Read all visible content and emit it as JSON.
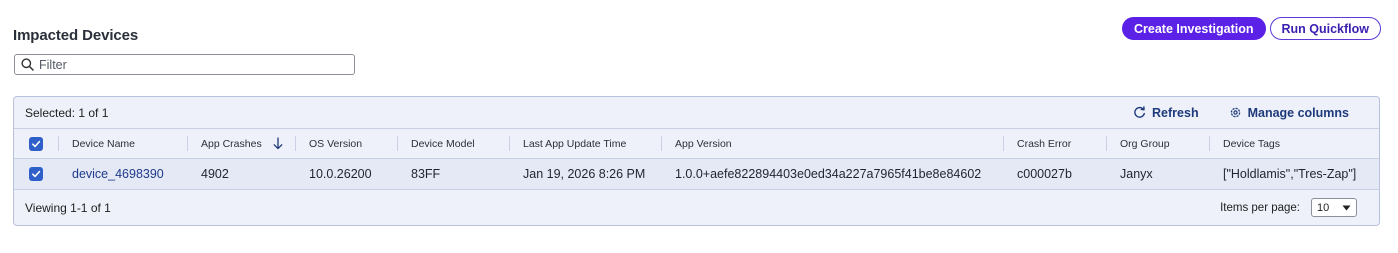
{
  "page": {
    "title": "Impacted Devices"
  },
  "actions": {
    "create_label": "Create Investigation",
    "quickflow_label": "Run Quickflow"
  },
  "filter": {
    "placeholder": "Filter",
    "value": ""
  },
  "grid": {
    "selected_text": "Selected: 1 of 1",
    "refresh_label": "Refresh",
    "manage_columns_label": "Manage columns",
    "columns": [
      "Device Name",
      "App Crashes",
      "OS Version",
      "Device Model",
      "Last App Update Time",
      "App Version",
      "Crash Error",
      "Org Group",
      "Device Tags"
    ],
    "sort": {
      "column": "App Crashes",
      "direction": "descending"
    },
    "rows": [
      {
        "selected": true,
        "device_name": "device_4698390",
        "app_crashes": "4902",
        "os_version": "10.0.26200",
        "device_model": "83FF",
        "last_app_update_time": "Jan 19, 2026 8:26 PM",
        "app_version": "1.0.0+aefe822894403e0ed34a227a7965f41be8e84602",
        "crash_error": "c000027b",
        "org_group": "Janyx",
        "device_tags": "[\"Holdlamis\",\"Tres-Zap\"]"
      }
    ],
    "footer": {
      "viewing_text": "Viewing 1-1 of 1",
      "items_per_page_label": "Items per page:",
      "items_per_page_value": "10"
    }
  },
  "colors": {
    "accent": "#5b21e6",
    "link": "#1e3a8a",
    "checkbox": "#2f5fc8",
    "grid_bg": "#eef1f9",
    "selected_row_bg": "#e5e9f6"
  },
  "icons": {
    "filter": "search-icon",
    "refresh": "refresh-icon",
    "manage_columns": "gear-icon",
    "sort": "arrow-down-icon",
    "select": "caret-down-icon",
    "checkbox": "checkmark-icon"
  }
}
